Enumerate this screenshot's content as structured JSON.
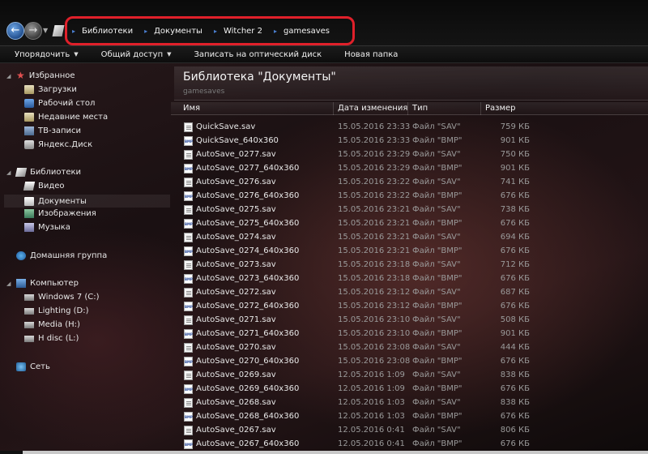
{
  "address": {
    "crumbs": [
      "Библиотеки",
      "Документы",
      "Witcher 2",
      "gamesaves"
    ],
    "highlight_color": "#e0202a"
  },
  "nav_buttons": {
    "back_icon": "arrow-left",
    "forward_icon": "arrow-right",
    "dropdown_icon": "chevron-down"
  },
  "toolbar": {
    "items": [
      {
        "label": "Упорядочить",
        "dropdown": true
      },
      {
        "label": "Общий доступ",
        "dropdown": true
      },
      {
        "label": "Записать на оптический диск",
        "dropdown": false
      },
      {
        "label": "Новая папка",
        "dropdown": false
      }
    ]
  },
  "sidebar": {
    "favorites": {
      "label": "Избранное",
      "items": [
        "Загрузки",
        "Рабочий стол",
        "Недавние места",
        "ТВ-записи",
        "Яндекс.Диск"
      ]
    },
    "libraries": {
      "label": "Библиотеки",
      "items": [
        "Видео",
        "Документы",
        "Изображения",
        "Музыка"
      ],
      "selected": "Документы"
    },
    "homegroup": {
      "label": "Домашняя группа"
    },
    "computer": {
      "label": "Компьютер",
      "items": [
        "Windows 7 (C:)",
        "Lighting (D:)",
        "Media (H:)",
        "H disc (L:)"
      ]
    },
    "network": {
      "label": "Сеть"
    }
  },
  "main": {
    "library_title": "Библиотека \"Документы\"",
    "library_subtitle": "gamesaves",
    "columns": {
      "name": "Имя",
      "date": "Дата изменения",
      "type": "Тип",
      "size": "Размер"
    },
    "files": [
      {
        "name": "QuickSave.sav",
        "date": "15.05.2016 23:33",
        "type": "Файл \"SAV\"",
        "size": "759 КБ",
        "kind": "sav"
      },
      {
        "name": "QuickSave_640x360",
        "date": "15.05.2016 23:33",
        "type": "Файл \"BMP\"",
        "size": "901 КБ",
        "kind": "bmp"
      },
      {
        "name": "AutoSave_0277.sav",
        "date": "15.05.2016 23:29",
        "type": "Файл \"SAV\"",
        "size": "750 КБ",
        "kind": "sav"
      },
      {
        "name": "AutoSave_0277_640x360",
        "date": "15.05.2016 23:29",
        "type": "Файл \"BMP\"",
        "size": "901 КБ",
        "kind": "bmp"
      },
      {
        "name": "AutoSave_0276.sav",
        "date": "15.05.2016 23:22",
        "type": "Файл \"SAV\"",
        "size": "741 КБ",
        "kind": "sav"
      },
      {
        "name": "AutoSave_0276_640x360",
        "date": "15.05.2016 23:22",
        "type": "Файл \"BMP\"",
        "size": "676 КБ",
        "kind": "bmp"
      },
      {
        "name": "AutoSave_0275.sav",
        "date": "15.05.2016 23:21",
        "type": "Файл \"SAV\"",
        "size": "738 КБ",
        "kind": "sav"
      },
      {
        "name": "AutoSave_0275_640x360",
        "date": "15.05.2016 23:21",
        "type": "Файл \"BMP\"",
        "size": "676 КБ",
        "kind": "bmp"
      },
      {
        "name": "AutoSave_0274.sav",
        "date": "15.05.2016 23:21",
        "type": "Файл \"SAV\"",
        "size": "694 КБ",
        "kind": "sav"
      },
      {
        "name": "AutoSave_0274_640x360",
        "date": "15.05.2016 23:21",
        "type": "Файл \"BMP\"",
        "size": "676 КБ",
        "kind": "bmp"
      },
      {
        "name": "AutoSave_0273.sav",
        "date": "15.05.2016 23:18",
        "type": "Файл \"SAV\"",
        "size": "712 КБ",
        "kind": "sav"
      },
      {
        "name": "AutoSave_0273_640x360",
        "date": "15.05.2016 23:18",
        "type": "Файл \"BMP\"",
        "size": "676 КБ",
        "kind": "bmp"
      },
      {
        "name": "AutoSave_0272.sav",
        "date": "15.05.2016 23:12",
        "type": "Файл \"SAV\"",
        "size": "687 КБ",
        "kind": "sav"
      },
      {
        "name": "AutoSave_0272_640x360",
        "date": "15.05.2016 23:12",
        "type": "Файл \"BMP\"",
        "size": "676 КБ",
        "kind": "bmp"
      },
      {
        "name": "AutoSave_0271.sav",
        "date": "15.05.2016 23:10",
        "type": "Файл \"SAV\"",
        "size": "508 КБ",
        "kind": "sav"
      },
      {
        "name": "AutoSave_0271_640x360",
        "date": "15.05.2016 23:10",
        "type": "Файл \"BMP\"",
        "size": "901 КБ",
        "kind": "bmp"
      },
      {
        "name": "AutoSave_0270.sav",
        "date": "15.05.2016 23:08",
        "type": "Файл \"SAV\"",
        "size": "444 КБ",
        "kind": "sav"
      },
      {
        "name": "AutoSave_0270_640x360",
        "date": "15.05.2016 23:08",
        "type": "Файл \"BMP\"",
        "size": "676 КБ",
        "kind": "bmp"
      },
      {
        "name": "AutoSave_0269.sav",
        "date": "12.05.2016 1:09",
        "type": "Файл \"SAV\"",
        "size": "838 КБ",
        "kind": "sav"
      },
      {
        "name": "AutoSave_0269_640x360",
        "date": "12.05.2016 1:09",
        "type": "Файл \"BMP\"",
        "size": "676 КБ",
        "kind": "bmp"
      },
      {
        "name": "AutoSave_0268.sav",
        "date": "12.05.2016 1:03",
        "type": "Файл \"SAV\"",
        "size": "838 КБ",
        "kind": "sav"
      },
      {
        "name": "AutoSave_0268_640x360",
        "date": "12.05.2016 1:03",
        "type": "Файл \"BMP\"",
        "size": "676 КБ",
        "kind": "bmp"
      },
      {
        "name": "AutoSave_0267.sav",
        "date": "12.05.2016 0:41",
        "type": "Файл \"SAV\"",
        "size": "806 КБ",
        "kind": "sav"
      },
      {
        "name": "AutoSave_0267_640x360",
        "date": "12.05.2016 0:41",
        "type": "Файл \"BMP\"",
        "size": "676 КБ",
        "kind": "bmp"
      }
    ]
  }
}
